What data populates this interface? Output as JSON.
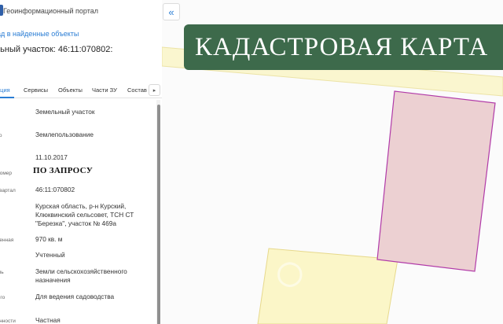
{
  "header": {
    "app_title": "Геоинформационный портал"
  },
  "nav": {
    "back_link": "ад в найденные объекты"
  },
  "object": {
    "title": "ельный участок: 46:11:070802:"
  },
  "tabs": [
    {
      "label": "ация",
      "active": true
    },
    {
      "label": "Сервисы"
    },
    {
      "label": "Объекты"
    },
    {
      "label": "Части ЗУ"
    },
    {
      "label": "Состав"
    }
  ],
  "tabs_next_icon": "chevron-right-icon",
  "collapse_icon": "double-chevron-left-icon",
  "attributes": [
    {
      "key": [
        "а",
        "ости"
      ],
      "value": "Земельный участок"
    },
    {
      "key": [
        "ьного"
      ],
      "value": "Землепользование"
    },
    {
      "key": [
        "ения"
      ],
      "value": "11.10.2017"
    },
    {
      "key": [
        "ый номер"
      ],
      "value": ""
    },
    {
      "key": [
        "ый квартал"
      ],
      "value": "46:11:070802"
    },
    {
      "key": [
        ""
      ],
      "value": "Курская область, р-н Курский, Клюквинский сельсовет, ТСН СТ \"Березка\", участок № 469а"
    },
    {
      "key": [
        "точненная"
      ],
      "value": "970 кв. м"
    },
    {
      "key": [
        ""
      ],
      "value": "Учтенный"
    },
    {
      "key": [
        "емель"
      ],
      "value": "Земли сельскохозяйственного назначения"
    },
    {
      "key": [
        "енного"
      ],
      "value": "Для ведения садоводства"
    },
    {
      "key": [
        "ственности"
      ],
      "value": "Частная"
    }
  ],
  "stamp": {
    "text": "ПО ЗАПРОСУ"
  },
  "banner": {
    "text": "КАДАСТРОВАЯ КАРТА"
  },
  "colors": {
    "accent": "#2a7dd4",
    "banner_bg": "#3d6a4b",
    "parcel_fill": "#ecd0d2",
    "parcel_stroke": "#b13aa8",
    "neighbor_fill": "#fbf6c8",
    "neighbor_stroke": "#e7d98c"
  }
}
